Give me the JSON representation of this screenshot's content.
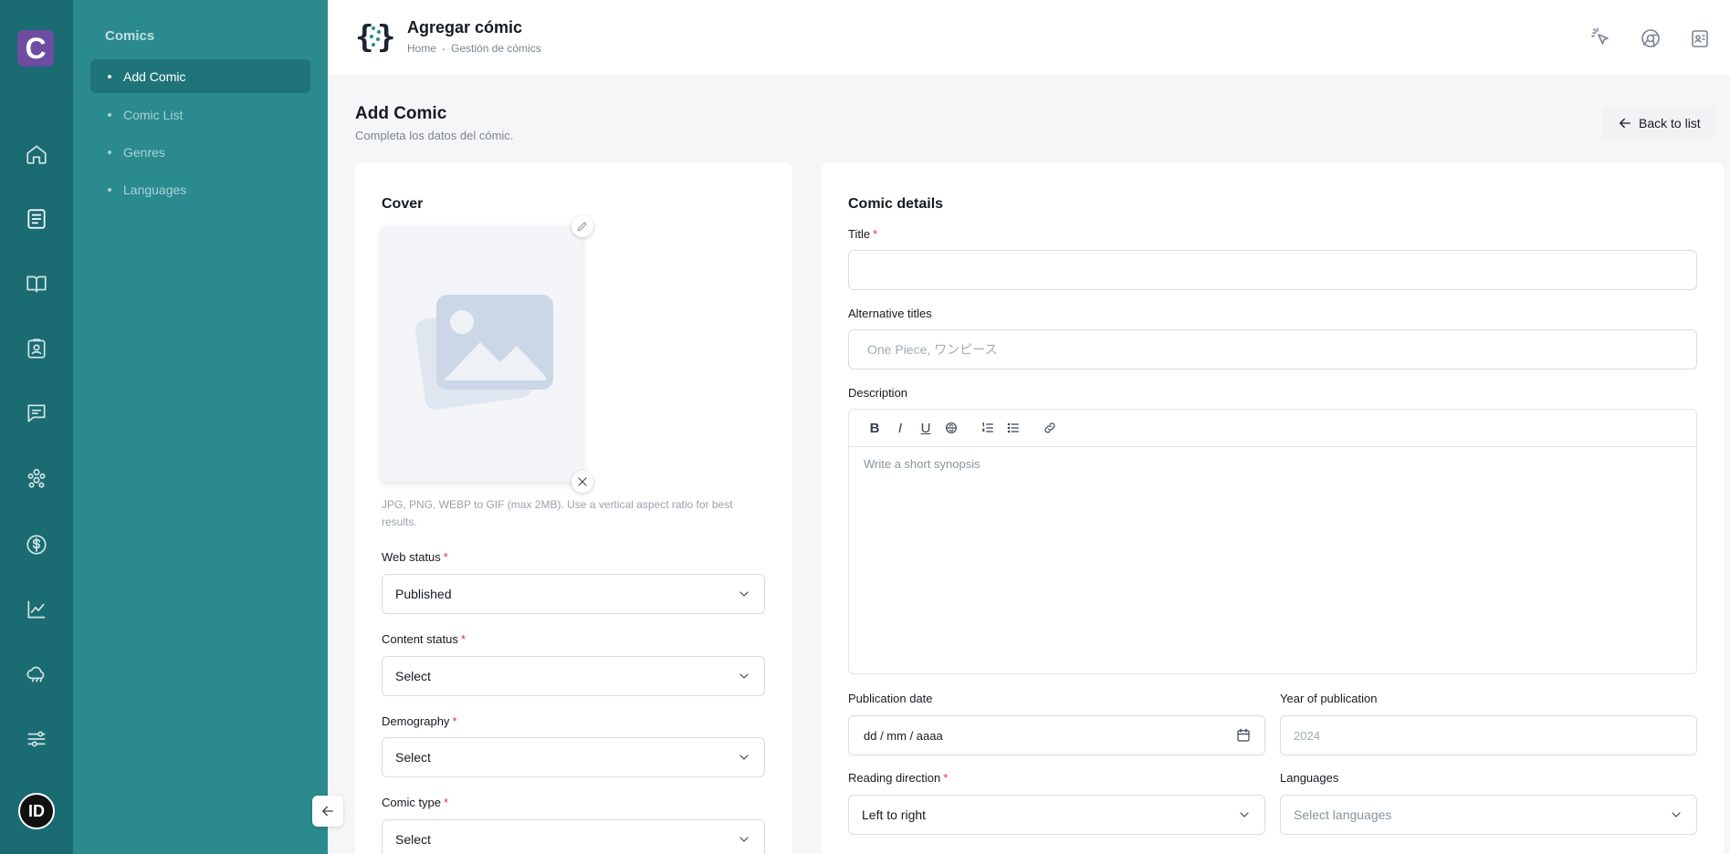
{
  "rail": {
    "logo_letter": "C",
    "icons": [
      "home-icon",
      "document-list-icon",
      "book-open-icon",
      "clipboard-user-icon",
      "chat-icon",
      "users-icon",
      "dollar-icon",
      "chart-icon",
      "cloud-icon",
      "sliders-icon"
    ],
    "user_initials": "ID"
  },
  "subnav": {
    "title": "Comics",
    "items": [
      {
        "label": "Add Comic",
        "active": true
      },
      {
        "label": "Comic List",
        "active": false
      },
      {
        "label": "Genres",
        "active": false
      },
      {
        "label": "Languages",
        "active": false
      }
    ]
  },
  "header": {
    "title": "Agregar cómic",
    "breadcrumb": [
      "Home",
      "-",
      "Gestión de cómics"
    ]
  },
  "page": {
    "title": "Add Comic",
    "subtitle": "Completa los datos del cómic.",
    "back_label": "Back to list"
  },
  "cover": {
    "title": "Cover",
    "hint": "JPG, PNG, WEBP to GIF (max 2MB). Use a vertical aspect ratio for best results."
  },
  "left_fields": {
    "web_status": {
      "label": "Web status",
      "value": "Published"
    },
    "content_status": {
      "label": "Content status",
      "value": "Select"
    },
    "demography": {
      "label": "Demography",
      "value": "Select"
    },
    "comic_type": {
      "label": "Comic type",
      "value": "Select"
    },
    "required_mark": "*"
  },
  "details": {
    "title": "Comic details",
    "title_label": "Title",
    "title_value": "",
    "alt_label": "Alternative titles",
    "alt_placeholder": "One Piece, ワンピース",
    "desc_label": "Description",
    "desc_placeholder": "Write a short synopsis",
    "toolbar": {
      "bold": "B",
      "italic": "I",
      "underline": "U"
    },
    "pub_date_label": "Publication date",
    "pub_date_value": "dd / mm / aaaa",
    "year_label": "Year of publication",
    "year_placeholder": "2024",
    "reading_label": "Reading direction",
    "reading_value": "Left to right",
    "languages_label": "Languages",
    "languages_placeholder": "Select languages"
  },
  "colors": {
    "rail": "#1a6b72",
    "subnav": "#2a8a8e",
    "subnav_active": "#1f7479",
    "logo": "#6e4ca0",
    "required": "#e0344a"
  }
}
